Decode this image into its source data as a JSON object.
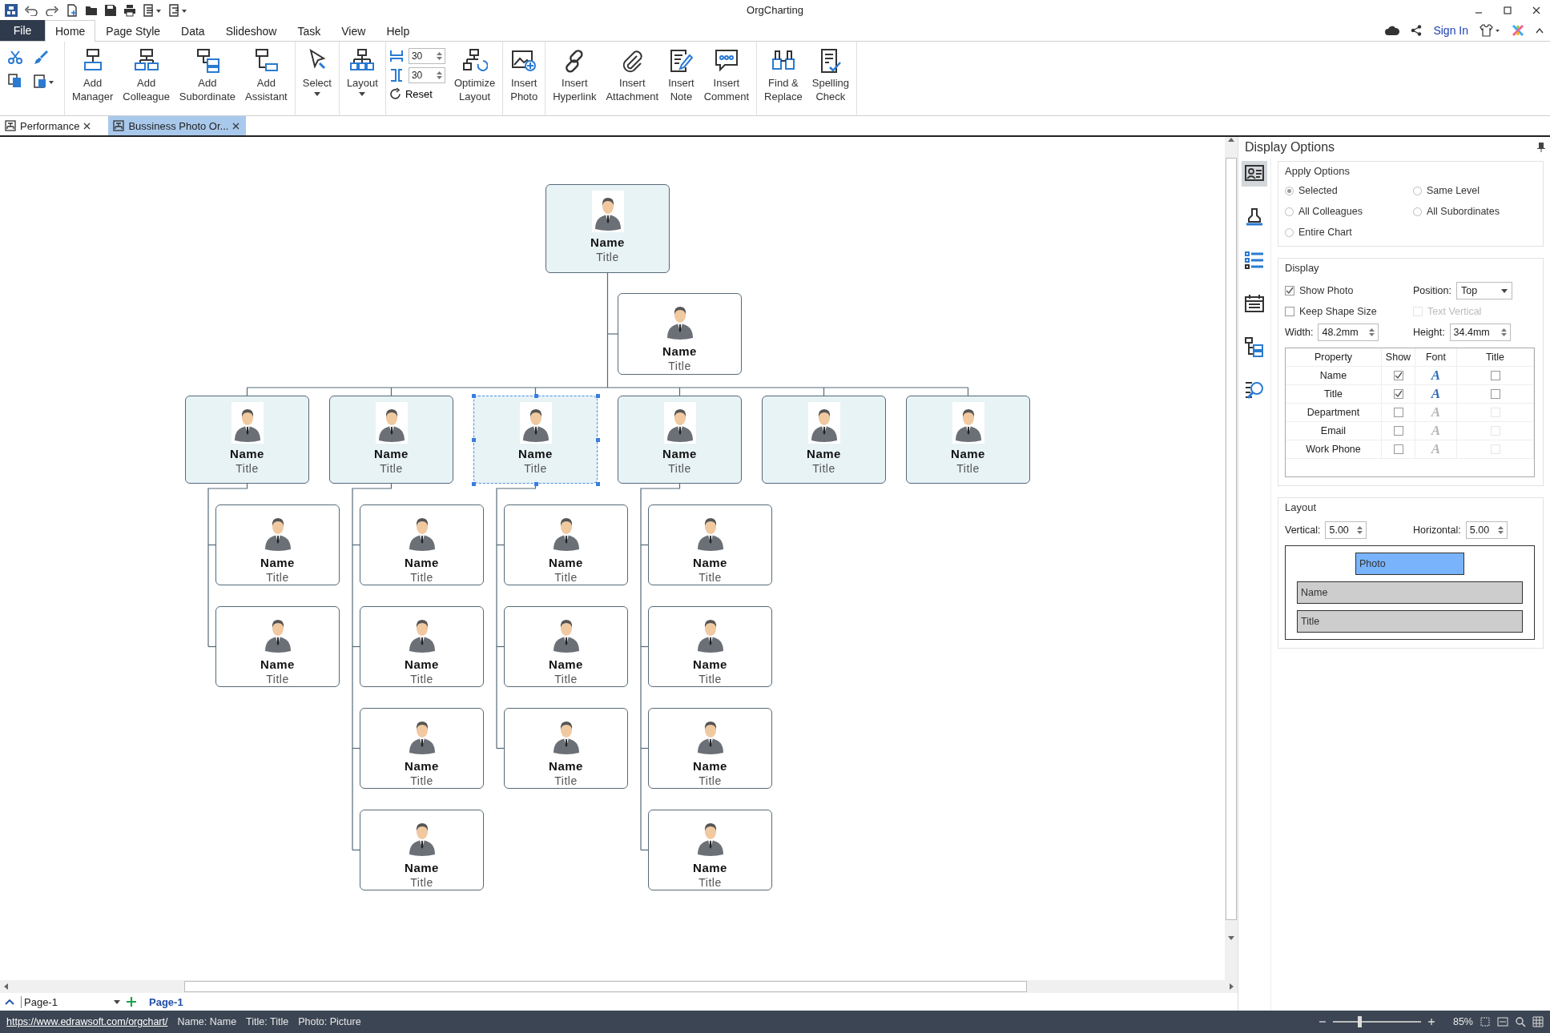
{
  "window": {
    "title": "OrgCharting"
  },
  "menu": {
    "file": "File",
    "tabs": [
      {
        "label": "Home",
        "selected": true
      },
      {
        "label": "Page Style",
        "selected": false
      },
      {
        "label": "Data",
        "selected": false
      },
      {
        "label": "Slideshow",
        "selected": false
      },
      {
        "label": "Task",
        "selected": false
      },
      {
        "label": "View",
        "selected": false
      },
      {
        "label": "Help",
        "selected": false
      }
    ],
    "sign_in": "Sign In"
  },
  "ribbon": {
    "groups": [
      {
        "kind": "buttons",
        "buttons": [
          {
            "label": "Add\nManager",
            "dropdown": false
          },
          {
            "label": "Add\nColleague",
            "dropdown": false
          },
          {
            "label": "Add\nSubordinate",
            "dropdown": false
          },
          {
            "label": "Add\nAssistant",
            "dropdown": false
          }
        ]
      },
      {
        "kind": "buttons",
        "buttons": [
          {
            "label": "Select",
            "dropdown": true
          }
        ]
      },
      {
        "kind": "buttons",
        "buttons": [
          {
            "label": "Layout",
            "dropdown": true
          }
        ]
      },
      {
        "kind": "spacing",
        "values": [
          "30",
          "30"
        ],
        "reset": "Reset",
        "buttons": [
          {
            "label": "Optimize\nLayout",
            "dropdown": false
          }
        ]
      },
      {
        "kind": "buttons",
        "buttons": [
          {
            "label": "Insert\nPhoto",
            "dropdown": false
          }
        ]
      },
      {
        "kind": "buttons",
        "buttons": [
          {
            "label": "Insert\nHyperlink",
            "dropdown": false
          },
          {
            "label": "Insert\nAttachment",
            "dropdown": false
          },
          {
            "label": "Insert\nNote",
            "dropdown": false
          },
          {
            "label": "Insert\nComment",
            "dropdown": false
          }
        ]
      },
      {
        "kind": "buttons",
        "buttons": [
          {
            "label": "Find &\nReplace",
            "dropdown": false
          },
          {
            "label": "Spelling\nCheck",
            "dropdown": false
          }
        ]
      }
    ]
  },
  "doc_tabs": [
    {
      "label": "Performance",
      "selected": false
    },
    {
      "label": "Bussiness Photo Or...",
      "selected": true
    }
  ],
  "chart": {
    "root": {
      "name": "Name",
      "title": "Title",
      "selected": false
    },
    "assistant": {
      "name": "Name",
      "title": "Title",
      "selected": false
    },
    "departments": [
      {
        "name": "Name",
        "title": "Title",
        "selected": false,
        "children": [
          {
            "name": "Name",
            "title": "Title",
            "selected": false
          },
          {
            "name": "Name",
            "title": "Title",
            "selected": false
          }
        ]
      },
      {
        "name": "Name",
        "title": "Title",
        "selected": false,
        "children": [
          {
            "name": "Name",
            "title": "Title",
            "selected": false
          },
          {
            "name": "Name",
            "title": "Title",
            "selected": false
          },
          {
            "name": "Name",
            "title": "Title",
            "selected": false
          },
          {
            "name": "Name",
            "title": "Title",
            "selected": false
          }
        ]
      },
      {
        "name": "Name",
        "title": "Title",
        "selected": true,
        "children": [
          {
            "name": "Name",
            "title": "Title",
            "selected": false
          },
          {
            "name": "Name",
            "title": "Title",
            "selected": false
          },
          {
            "name": "Name",
            "title": "Title",
            "selected": false
          }
        ]
      },
      {
        "name": "Name",
        "title": "Title",
        "selected": false,
        "children": [
          {
            "name": "Name",
            "title": "Title",
            "selected": false
          },
          {
            "name": "Name",
            "title": "Title",
            "selected": false
          },
          {
            "name": "Name",
            "title": "Title",
            "selected": false
          },
          {
            "name": "Name",
            "title": "Title",
            "selected": false
          }
        ]
      },
      {
        "name": "Name",
        "title": "Title",
        "selected": false
      },
      {
        "name": "Name",
        "title": "Title",
        "selected": false
      }
    ]
  },
  "panel": {
    "title": "Display Options",
    "tools": [
      {
        "selected": true
      },
      {
        "selected": false
      },
      {
        "selected": false
      },
      {
        "selected": false
      },
      {
        "selected": false
      },
      {
        "selected": false
      }
    ],
    "apply": {
      "heading": "Apply Options",
      "options": [
        {
          "label": "Selected",
          "selected": true
        },
        {
          "label": "Same Level",
          "selected": false
        },
        {
          "label": "All Colleagues",
          "selected": false
        },
        {
          "label": "All Subordinates",
          "selected": false
        },
        {
          "label": "Entire Chart",
          "selected": false
        }
      ]
    },
    "display": {
      "heading": "Display",
      "show_photo": {
        "label": "Show Photo",
        "checked": true,
        "disabled": false
      },
      "position": {
        "label": "Position:",
        "value": "Top"
      },
      "keep_size": {
        "label": "Keep Shape Size",
        "checked": false,
        "disabled": false
      },
      "text_vertical": {
        "label": "Text Vertical",
        "checked": false,
        "disabled": true
      },
      "width": {
        "label": "Width:",
        "value": "48.2mm"
      },
      "height": {
        "label": "Height:",
        "value": "34.4mm"
      },
      "table": {
        "columns": [
          "Property",
          "Show",
          "Font",
          "Title"
        ],
        "rows": [
          {
            "property": "Name",
            "show": true,
            "font": "A",
            "enabled": true,
            "title": false
          },
          {
            "property": "Title",
            "show": true,
            "font": "A",
            "enabled": true,
            "title": false
          },
          {
            "property": "Department",
            "show": false,
            "font": "A",
            "enabled": false,
            "title": false
          },
          {
            "property": "Email",
            "show": false,
            "font": "A",
            "enabled": false,
            "title": false
          },
          {
            "property": "Work Phone",
            "show": false,
            "font": "A",
            "enabled": false,
            "title": false
          }
        ]
      }
    },
    "layout": {
      "heading": "Layout",
      "vertical": {
        "label": "Vertical:",
        "value": "5.00"
      },
      "horizontal": {
        "label": "Horizontal:",
        "value": "5.00"
      },
      "preview": [
        {
          "label": "Photo",
          "selected": true
        },
        {
          "label": "Name",
          "selected": false
        },
        {
          "label": "Title",
          "selected": false
        }
      ]
    }
  },
  "pages": {
    "current": "Page-1",
    "tabs": [
      {
        "label": "Page-1",
        "selected": true
      }
    ]
  },
  "status": {
    "link": "https://www.edrawsoft.com/orgchart/",
    "items": [
      "Name: Name",
      "Title: Title",
      "Photo: Picture"
    ],
    "zoom": {
      "level": 0.3,
      "reading": "85%"
    }
  }
}
